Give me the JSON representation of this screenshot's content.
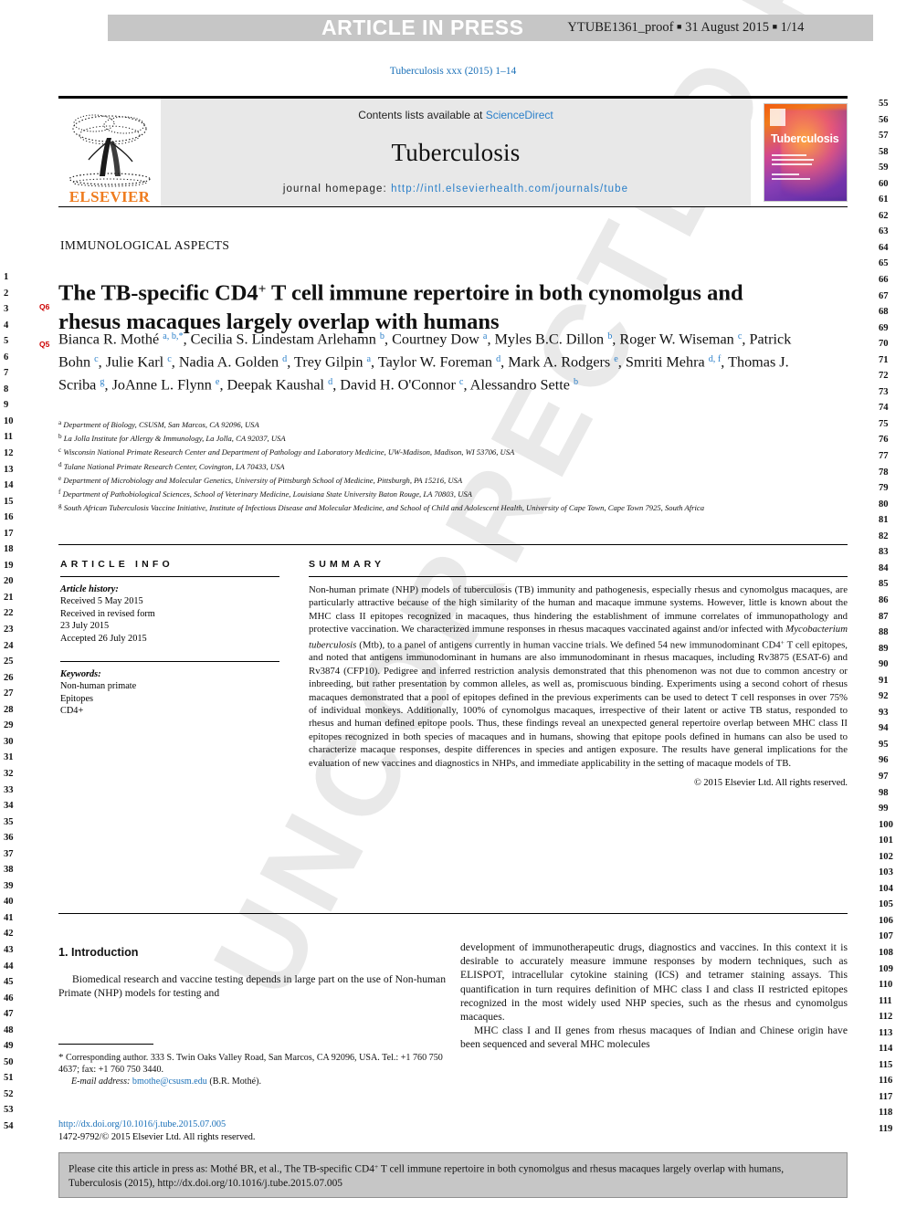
{
  "header": {
    "article_in_press": "ARTICLE IN PRESS",
    "proof_id": "YTUBE1361_proof",
    "proof_sep": "■",
    "proof_date": "31 August 2015",
    "proof_page": "1/14",
    "journal_ref": "Tuberculosis xxx (2015) 1–14"
  },
  "masthead": {
    "publisher": "ELSEVIER",
    "contents_prefix": "Contents lists available at ",
    "contents_link": "ScienceDirect",
    "journal_name": "Tuberculosis",
    "homepage_label": "journal homepage: ",
    "homepage_url": "http://intl.elsevierhealth.com/journals/tube",
    "cover_title": "Tuberculosis"
  },
  "article": {
    "section_label": "IMMUNOLOGICAL ASPECTS",
    "title_line1_a": "The TB-specific CD4",
    "title_sup": "+",
    "title_line1_b": " T cell immune repertoire in both cynomolgus",
    "title_line2": "and rhesus macaques largely overlap with humans",
    "query_tag_title": "Q6",
    "query_tag_authors": "Q5",
    "authors_html": "Bianca R. Mothé <sup>a, b,*</sup>, Cecilia S. Lindestam Arlehamn <sup>b</sup>, Courtney Dow <sup>a</sup>, Myles B.C. Dillon <sup>b</sup>, Roger W. Wiseman <sup>c</sup>, Patrick Bohn <sup>c</sup>, Julie Karl <sup>c</sup>, Nadia A. Golden <sup>d</sup>, Trey Gilpin <sup>a</sup>, Taylor W. Foreman <sup>d</sup>, Mark A. Rodgers <sup>e</sup>, Smriti Mehra <sup>d, f</sup>, Thomas J. Scriba <sup>g</sup>, JoAnne L. Flynn <sup>e</sup>, Deepak Kaushal <sup>d</sup>, David H. O'Connor <sup>c</sup>, Alessandro Sette <sup>b</sup>",
    "affiliations": [
      {
        "label": "a",
        "text": "Department of Biology, CSUSM, San Marcos, CA 92096, USA"
      },
      {
        "label": "b",
        "text": "La Jolla Institute for Allergy & Immunology, La Jolla, CA 92037, USA"
      },
      {
        "label": "c",
        "text": "Wisconsin National Primate Research Center and Department of Pathology and Laboratory Medicine, UW-Madison, Madison, WI 53706, USA"
      },
      {
        "label": "d",
        "text": "Tulane National Primate Research Center, Covington, LA 70433, USA"
      },
      {
        "label": "e",
        "text": "Department of Microbiology and Molecular Genetics, University of Pittsburgh School of Medicine, Pittsburgh, PA 15216, USA"
      },
      {
        "label": "f",
        "text": "Department of Pathobiological Sciences, School of Veterinary Medicine, Louisiana State University Baton Rouge, LA 70803, USA"
      },
      {
        "label": "g",
        "text": "South African Tuberculosis Vaccine Initiative, Institute of Infectious Disease and Molecular Medicine, and School of Child and Adolescent Health, University of Cape Town, Cape Town 7925, South Africa"
      }
    ]
  },
  "article_info": {
    "heading": "ARTICLE INFO",
    "history_label": "Article history:",
    "history_lines": [
      "Received 5 May 2015",
      "Received in revised form",
      "23 July 2015",
      "Accepted 26 July 2015"
    ],
    "keywords_label": "Keywords:",
    "keywords": [
      "Non-human primate",
      "Epitopes",
      "CD4+"
    ]
  },
  "summary": {
    "heading": "SUMMARY",
    "text_html": "Non-human primate (NHP) models of tuberculosis (TB) immunity and pathogenesis, especially rhesus and cynomolgus macaques, are particularly attractive because of the high similarity of the human and macaque immune systems. However, little is known about the MHC class II epitopes recognized in macaques, thus hindering the establishment of immune correlates of immunopathology and protective vaccination. We characterized immune responses in rhesus macaques vaccinated against and/or infected with <i>Mycobacterium tuberculosis</i> (Mtb), to a panel of antigens currently in human vaccine trials. We defined 54 new immunodominant CD4<sup>+</sup> T cell epitopes, and noted that antigens immunodominant in humans are also immunodominant in rhesus macaques, including Rv3875 (ESAT-6) and Rv3874 (CFP10). Pedigree and inferred restriction analysis demonstrated that this phenomenon was not due to common ancestry or inbreeding, but rather presentation by common alleles, as well as, promiscuous binding. Experiments using a second cohort of rhesus macaques demonstrated that a pool of epitopes defined in the previous experiments can be used to detect T cell responses in over 75% of individual monkeys. Additionally, 100% of cynomolgus macaques, irrespective of their latent or active TB status, responded to rhesus and human defined epitope pools. Thus, these findings reveal an unexpected general repertoire overlap between MHC class II epitopes recognized in both species of macaques and in humans, showing that epitope pools defined in humans can also be used to characterize macaque responses, despite differences in species and antigen exposure. The results have general implications for the evaluation of new vaccines and diagnostics in NHPs, and immediate applicability in the setting of macaque models of TB.",
    "copyright": "© 2015 Elsevier Ltd. All rights reserved."
  },
  "body": {
    "intro_heading": "1. Introduction",
    "left_paragraph": "Biomedical research and vaccine testing depends in large part on the use of Non-human Primate (NHP) models for testing and",
    "right_paragraph_1": "development of immunotherapeutic drugs, diagnostics and vaccines. In this context it is desirable to accurately measure immune responses by modern techniques, such as ELISPOT, intracellular cytokine staining (ICS) and tetramer staining assays. This quantification in turn requires definition of MHC class I and class II restricted epitopes recognized in the most widely used NHP species, such as the rhesus and cynomolgus macaques.",
    "right_paragraph_2": "MHC class I and II genes from rhesus macaques of Indian and Chinese origin have been sequenced and several MHC molecules"
  },
  "footnote": {
    "star": "*",
    "corresponding": " Corresponding author. 333 S. Twin Oaks Valley Road, San Marcos, CA 92096, USA. Tel.: +1 760 750 4637; fax: +1 760 750 3440.",
    "email_label": "E-mail address:",
    "email": "bmothe@csusm.edu",
    "email_owner": "(B.R. Mothé)."
  },
  "pubinfo": {
    "doi": "http://dx.doi.org/10.1016/j.tube.2015.07.005",
    "issn_line": "1472-9792/© 2015 Elsevier Ltd. All rights reserved."
  },
  "cite_box": {
    "prefix": "Please cite this article in press as: Mothé BR, et al., The TB-specific CD4",
    "sup": "+",
    "suffix": " T cell immune repertoire in both cynomolgus and rhesus macaques largely overlap with humans, Tuberculosis (2015), http://dx.doi.org/10.1016/j.tube.2015.07.005"
  },
  "line_numbers": {
    "left_start": 1,
    "left_end": 54,
    "right_start": 55,
    "right_end": 119
  },
  "watermark": {
    "text": "UNCORRECTED PROOF"
  },
  "colors": {
    "link": "#1a70b8",
    "elsevier_orange": "#ef7c1f",
    "query_red": "#cc0000",
    "bar_gray": "#c6c6c6",
    "mast_gray": "#e8e8e8"
  }
}
